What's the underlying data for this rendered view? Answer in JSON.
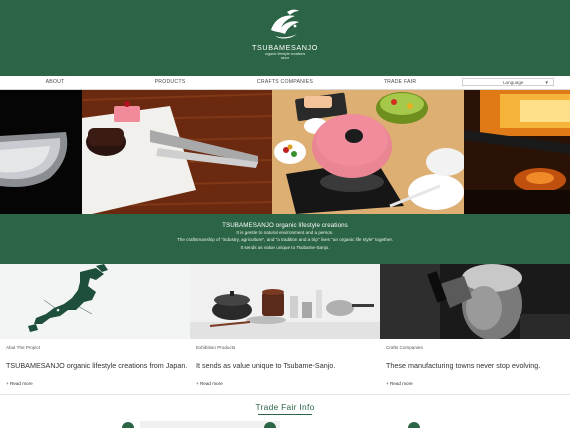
{
  "brand": {
    "name": "TSUBAMESANJO",
    "tagline_1": "organic lifestyle creations",
    "tagline_2": "since"
  },
  "nav": {
    "items": [
      "ABOUT",
      "PRODUCTS",
      "CRAFTS COMPANIES",
      "TRADE FAIR"
    ],
    "language_label": "Language"
  },
  "intro": {
    "title": "TSUBAMESANJO organic lifestyle creations",
    "lines": [
      "It is gentle to natural environment and a person.",
      "The craftsmanship of \"industry, agriculture\", and \"a tradition and a trip\" lives \"an organic life style\" together.",
      "It sends as value unique to Tsubame-Sanjo."
    ]
  },
  "cards": [
    {
      "label": "Abut The Project",
      "headline": "TSUBAMESANJO organic lifestyle creations from Japan.",
      "more": "+ Read more"
    },
    {
      "label": "Exhibition Products",
      "headline": "It sends as value unique to Tsubame-Sanjo.",
      "more": "+ Read more"
    },
    {
      "label": "Crafts Companies",
      "headline": "These manufacturing towns never stop evolving.",
      "more": "+ Read more"
    }
  ],
  "trade_fair": {
    "title": "Trade Fair Info"
  },
  "colors": {
    "brand_green": "#2c6446",
    "accent_pink": "#e8707a"
  }
}
